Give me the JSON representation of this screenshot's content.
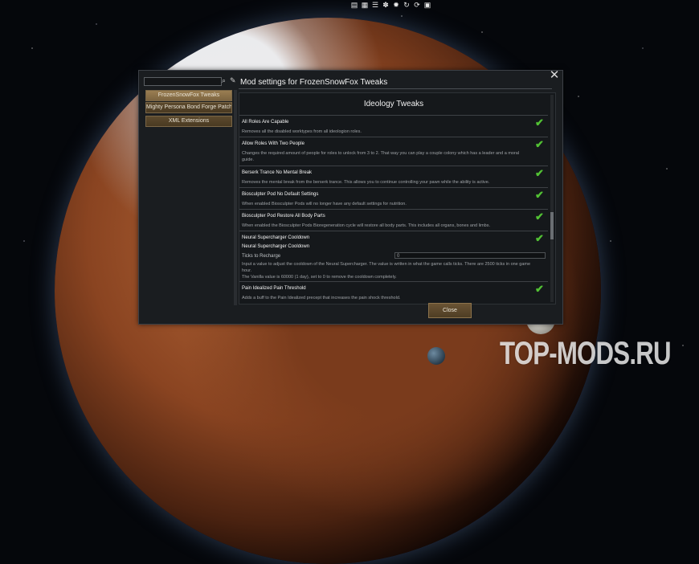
{
  "toolbar": {
    "icons": [
      "list-icon",
      "grid-icon",
      "menu-icon",
      "paw-icon",
      "gear-icon",
      "refresh-icon",
      "cycle-icon",
      "image-icon"
    ]
  },
  "dialog": {
    "close_symbol": "✕",
    "mod_list": [
      {
        "label": "FrozenSnowFox Tweaks",
        "selected": true
      },
      {
        "label": "Mighty Persona Bond Forge Patch Mod",
        "selected": false
      },
      {
        "label": "XML Extensions",
        "selected": false
      }
    ],
    "title": "Mod settings for FrozenSnowFox Tweaks",
    "section_heading": "Ideology Tweaks",
    "settings": [
      {
        "title": "All Roles Are Capable",
        "desc": "Removes all the disabled worktypes from all ideologion roles.",
        "checked": true
      },
      {
        "title": "Allow Roles With Two People",
        "desc": "Changes the required amount of people for roles to unlock from 3 to 2.  That way you can play a couple colony which has a leader and a moral guide.",
        "checked": true
      },
      {
        "title": "Berserk Trance No Mental Break",
        "desc": "Removes the mental break from the berserk trance.  This allows you to continue controlling your pawn while the ability is active.",
        "checked": true
      },
      {
        "title": "Biosculpter Pod No Default Settings",
        "desc": "When enabled Biosculpter Pods will no longer have any default settings for nutrition.",
        "checked": true
      },
      {
        "title": "Biosculpter Pod Restore All Body Parts",
        "desc": "When enabled the Biosculpter Pods Bioregeneration cycle will restore all body parts.  This includes all organs, bones and limbs.",
        "checked": true
      },
      {
        "title": "Neural Supercharger Cooldown",
        "checked": true,
        "subtitle": "Neural Supercharger Cooldown",
        "ticks_label": "Ticks to Recharge",
        "ticks_value": "0",
        "desc": "Input a value to adjust the cooldown of the Neural Supercharger.  The value is written in what the game calls ticks.  There are 2500 ticks in one game hour.",
        "desc2": "The Vanilla value is 60000 (1 day), set to 0 to remove the cooldown completely."
      },
      {
        "title": "Pain Idealized Pain Threshold",
        "desc": "Adds a buff to the Pain Idealized precept that increases the pain shock threshold.",
        "checked": true
      }
    ],
    "close_label": "Close"
  },
  "watermark": "TOP-MODS.RU",
  "colors": {
    "check": "#52c234",
    "button": "#5c4a2e",
    "dialog_bg": "#1a1d20"
  }
}
